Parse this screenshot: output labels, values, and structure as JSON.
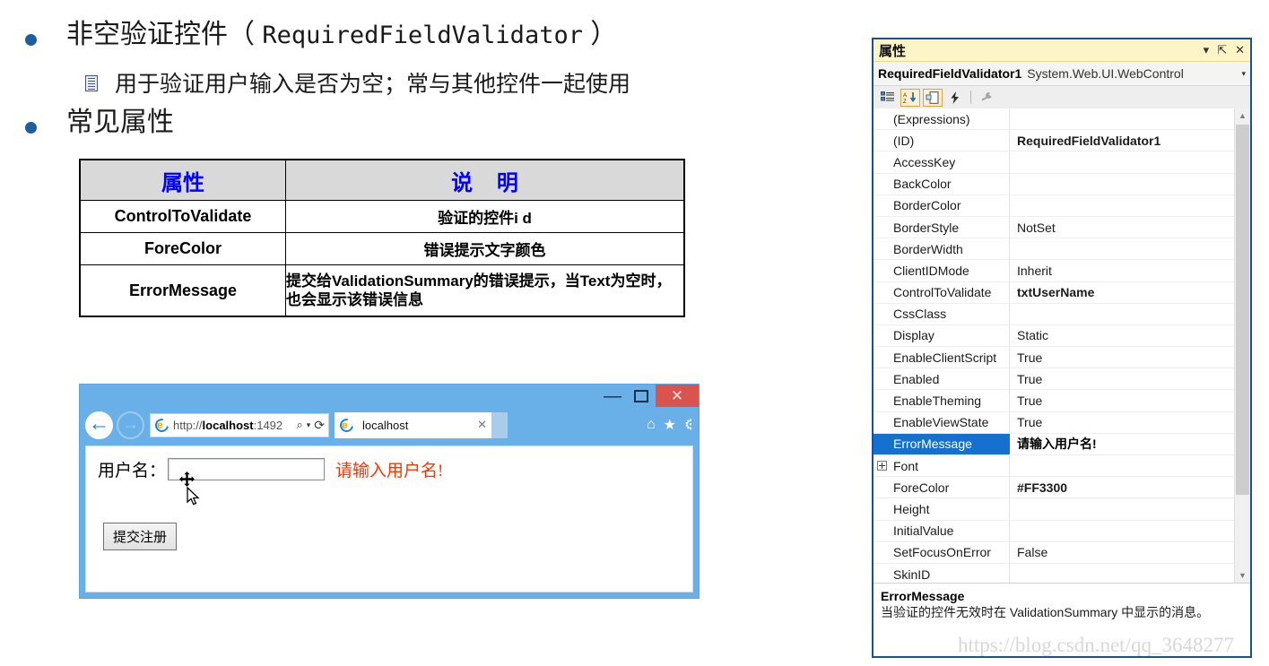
{
  "slide": {
    "bullet1": {
      "text_prefix": "非空验证控件（ ",
      "text_mono": "RequiredFieldValidator",
      "text_suffix": " ）"
    },
    "sub_bullet1": "用于验证用户输入是否为空；常与其他控件一起使用",
    "bullet2": "常见属性"
  },
  "table": {
    "headers": [
      "属性",
      "说  明"
    ],
    "rows": [
      {
        "key": "ControlToValidate",
        "value": "验证的控件i d"
      },
      {
        "key": "ForeColor",
        "value": "错误提示文字颜色"
      },
      {
        "key": "ErrorMessage",
        "value": "提交给ValidationSummary的错误提示，当Text为空时，也会显示该错误信息"
      }
    ]
  },
  "browser": {
    "window_buttons": {
      "minimize": "—",
      "maximize": "□",
      "close": "✕"
    },
    "back_icon": "←",
    "forward_icon": "→",
    "address_url_prefix": "http://",
    "address_url_host": "localhost",
    "address_url_rest": ":1492",
    "search_icon": "⌕",
    "dropdown_icon": "▾",
    "refresh_icon": "⟳",
    "tab_title": "localhost",
    "tab_close": "✕",
    "home_icon": "⌂",
    "favorites_icon": "★",
    "tools_icon": "⚙",
    "page": {
      "label": "用户名：",
      "input_value": "",
      "input_placeholder": "",
      "error_message": "请输入用户名!",
      "submit_label": "提交注册"
    }
  },
  "properties_panel": {
    "title": "属性",
    "title_actions": {
      "dropdown": "▾",
      "pin": "⇱",
      "close": "✕"
    },
    "object_name": "RequiredFieldValidator1",
    "object_type": "System.Web.UI.WebControl",
    "object_caret": "▾",
    "toolbar": {
      "categorized": "categorized-icon",
      "alphabetical": "alphabetical-sort-icon",
      "properties_page": "properties-page-icon",
      "events": "events-lightning-icon",
      "wrench": "wrench-icon"
    },
    "rows": [
      {
        "name": "(Expressions)",
        "value": "",
        "bold": false,
        "selected": false,
        "expander": false
      },
      {
        "name": "(ID)",
        "value": "RequiredFieldValidator1",
        "bold": true,
        "selected": false,
        "expander": false
      },
      {
        "name": "AccessKey",
        "value": "",
        "bold": false,
        "selected": false,
        "expander": false
      },
      {
        "name": "BackColor",
        "value": "",
        "bold": false,
        "selected": false,
        "expander": false
      },
      {
        "name": "BorderColor",
        "value": "",
        "bold": false,
        "selected": false,
        "expander": false
      },
      {
        "name": "BorderStyle",
        "value": "NotSet",
        "bold": false,
        "selected": false,
        "expander": false
      },
      {
        "name": "BorderWidth",
        "value": "",
        "bold": false,
        "selected": false,
        "expander": false
      },
      {
        "name": "ClientIDMode",
        "value": "Inherit",
        "bold": false,
        "selected": false,
        "expander": false
      },
      {
        "name": "ControlToValidate",
        "value": "txtUserName",
        "bold": true,
        "selected": false,
        "expander": false
      },
      {
        "name": "CssClass",
        "value": "",
        "bold": false,
        "selected": false,
        "expander": false
      },
      {
        "name": "Display",
        "value": "Static",
        "bold": false,
        "selected": false,
        "expander": false
      },
      {
        "name": "EnableClientScript",
        "value": "True",
        "bold": false,
        "selected": false,
        "expander": false
      },
      {
        "name": "Enabled",
        "value": "True",
        "bold": false,
        "selected": false,
        "expander": false
      },
      {
        "name": "EnableTheming",
        "value": "True",
        "bold": false,
        "selected": false,
        "expander": false
      },
      {
        "name": "EnableViewState",
        "value": "True",
        "bold": false,
        "selected": false,
        "expander": false
      },
      {
        "name": "ErrorMessage",
        "value": "请输入用户名!",
        "bold": true,
        "selected": true,
        "expander": false
      },
      {
        "name": "Font",
        "value": "",
        "bold": false,
        "selected": false,
        "expander": true
      },
      {
        "name": "ForeColor",
        "value": "#FF3300",
        "bold": true,
        "selected": false,
        "expander": false
      },
      {
        "name": "Height",
        "value": "",
        "bold": false,
        "selected": false,
        "expander": false
      },
      {
        "name": "InitialValue",
        "value": "",
        "bold": false,
        "selected": false,
        "expander": false
      },
      {
        "name": "SetFocusOnError",
        "value": "False",
        "bold": false,
        "selected": false,
        "expander": false
      },
      {
        "name": "SkinID",
        "value": "",
        "bold": false,
        "selected": false,
        "expander": false
      }
    ],
    "scrollbar": {
      "up": "▲",
      "down": "▼"
    },
    "description": {
      "title": "ErrorMessage",
      "body": "当验证的控件无效时在 ValidationSummary 中显示的消息。"
    }
  },
  "watermark": "https://blog.csdn.net/qq_3648277",
  "colors": {
    "bullet": "#1f5e9e",
    "table_header_bg": "#d9d9d9",
    "table_header_text": "#0000ff",
    "error_text": "#FF3300",
    "panel_border": "#1b4f9c",
    "panel_title_bg": "#fdf4c8",
    "row_selected_bg": "#1570d0",
    "browser_chrome": "#6ab0e8",
    "close_button": "#d9534f"
  }
}
